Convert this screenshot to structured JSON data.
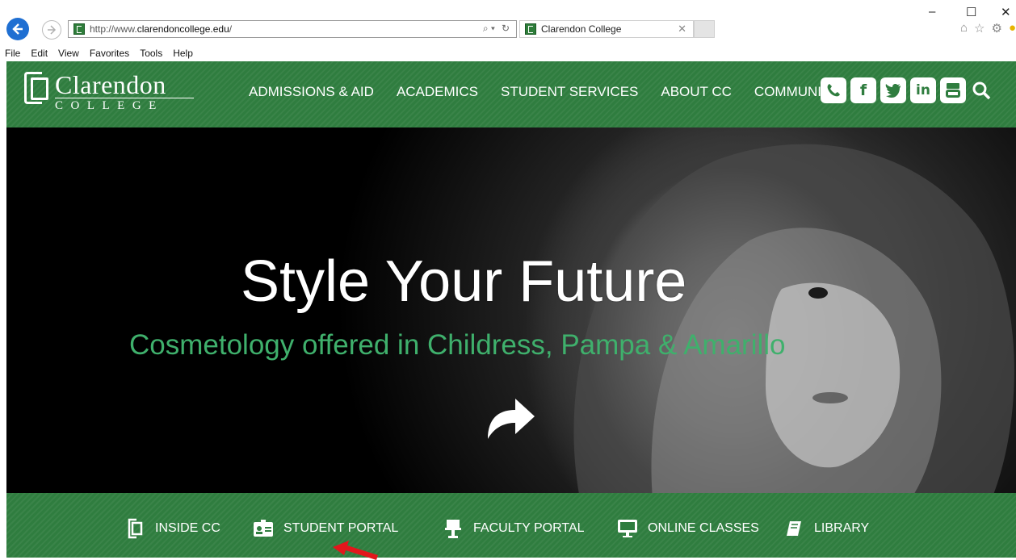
{
  "browser": {
    "url_prefix": "http://www.",
    "url_domain": "clarendoncollege.edu",
    "url_suffix": "/",
    "tab_title": "Clarendon College",
    "menu": [
      "File",
      "Edit",
      "View",
      "Favorites",
      "Tools",
      "Help"
    ]
  },
  "site": {
    "logo_name": "Clarendon",
    "logo_sub": "COLLEGE",
    "nav": [
      "ADMISSIONS & AID",
      "ACADEMICS",
      "STUDENT SERVICES",
      "ABOUT CC",
      "COMMUNITY"
    ],
    "social_icons": [
      "phone-icon",
      "facebook-icon",
      "twitter-icon",
      "linkedin-icon",
      "youtube-icon",
      "search-icon"
    ]
  },
  "hero": {
    "headline": "Style Your Future",
    "subline": "Cosmetology offered in Childress, Pampa & Amarillo"
  },
  "quicklinks": [
    {
      "label": "INSIDE CC",
      "icon": "cc-logo-icon"
    },
    {
      "label": "STUDENT PORTAL",
      "icon": "id-card-icon"
    },
    {
      "label": "FACULTY PORTAL",
      "icon": "podium-icon"
    },
    {
      "label": "ONLINE CLASSES",
      "icon": "monitor-icon"
    },
    {
      "label": "LIBRARY",
      "icon": "book-icon"
    }
  ],
  "colors": {
    "brand_green": "#2f7d3f",
    "subline_green": "#3fb06c",
    "annotation_red": "#e3161c"
  }
}
